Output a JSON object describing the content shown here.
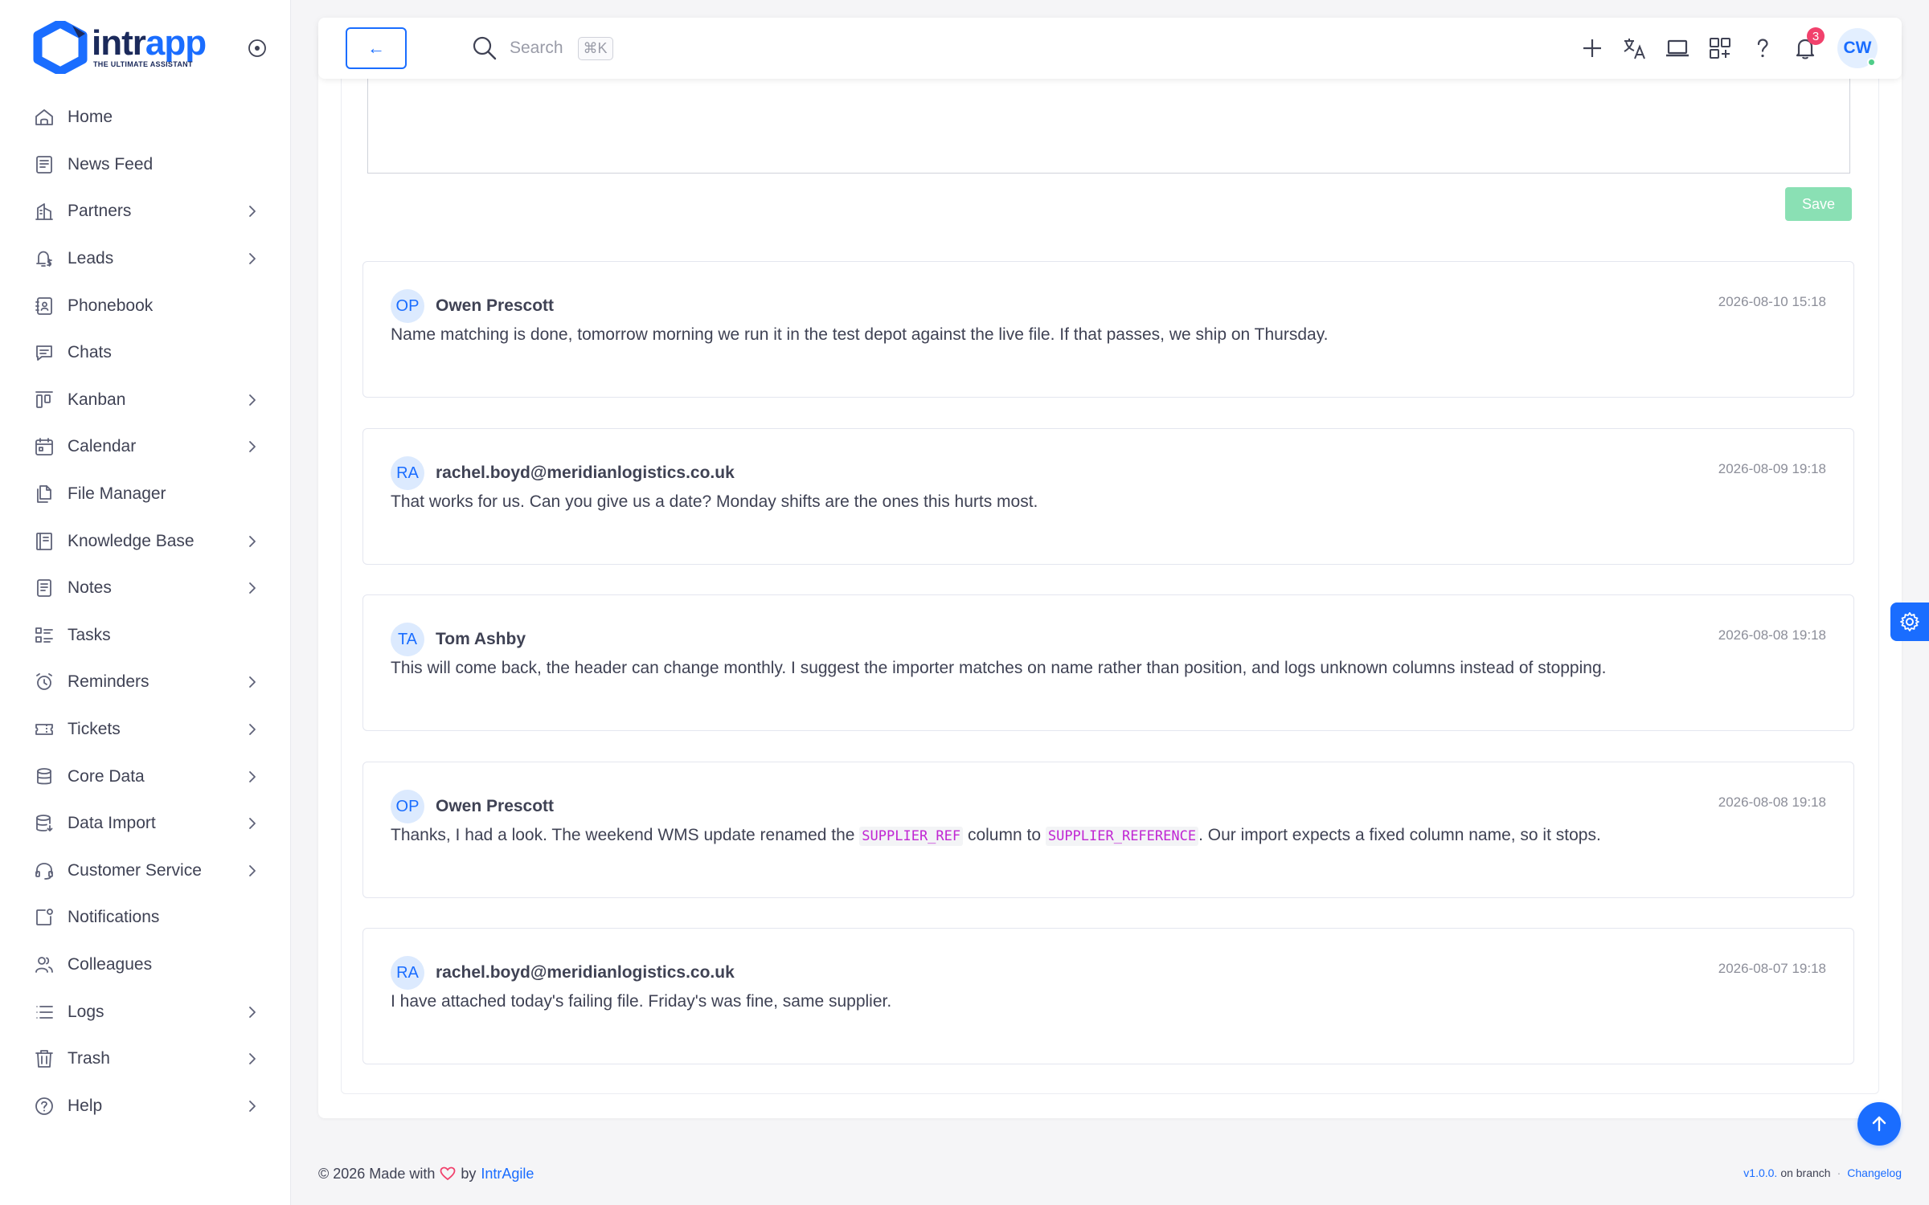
{
  "brand": {
    "name_main": "intr",
    "name_accent": "app",
    "tagline": "THE ULTIMATE ASSISTANT"
  },
  "sidebar": {
    "items": [
      {
        "label": "Home",
        "icon": "home-icon",
        "chevron": false
      },
      {
        "label": "News Feed",
        "icon": "newspaper-icon",
        "chevron": false
      },
      {
        "label": "Partners",
        "icon": "building-icon",
        "chevron": true
      },
      {
        "label": "Leads",
        "icon": "bell-dollar-icon",
        "chevron": true
      },
      {
        "label": "Phonebook",
        "icon": "phonebook-icon",
        "chevron": false
      },
      {
        "label": "Chats",
        "icon": "chat-icon",
        "chevron": false
      },
      {
        "label": "Kanban",
        "icon": "kanban-icon",
        "chevron": true
      },
      {
        "label": "Calendar",
        "icon": "calendar-icon",
        "chevron": true
      },
      {
        "label": "File Manager",
        "icon": "files-icon",
        "chevron": false
      },
      {
        "label": "Knowledge Base",
        "icon": "book-icon",
        "chevron": true
      },
      {
        "label": "Notes",
        "icon": "note-icon",
        "chevron": true
      },
      {
        "label": "Tasks",
        "icon": "tasks-icon",
        "chevron": false
      },
      {
        "label": "Reminders",
        "icon": "alarm-icon",
        "chevron": true
      },
      {
        "label": "Tickets",
        "icon": "ticket-icon",
        "chevron": true
      },
      {
        "label": "Core Data",
        "icon": "database-icon",
        "chevron": true
      },
      {
        "label": "Data Import",
        "icon": "database-import-icon",
        "chevron": true
      },
      {
        "label": "Customer Service",
        "icon": "headset-icon",
        "chevron": true
      },
      {
        "label": "Notifications",
        "icon": "notification-icon",
        "chevron": false
      },
      {
        "label": "Colleagues",
        "icon": "users-icon",
        "chevron": false
      },
      {
        "label": "Logs",
        "icon": "list-icon",
        "chevron": true
      },
      {
        "label": "Trash",
        "icon": "trash-icon",
        "chevron": true
      },
      {
        "label": "Help",
        "icon": "help-circle-icon",
        "chevron": true
      }
    ]
  },
  "topbar": {
    "back_label": "←",
    "search_placeholder": "Search",
    "search_shortcut": "⌘K",
    "notifications_count": "3",
    "user_initials": "CW"
  },
  "editor": {
    "save_label": "Save"
  },
  "comments": [
    {
      "initials": "OP",
      "author": "Owen Prescott",
      "date": "2026-08-10 15:18",
      "text": "Name matching is done, tomorrow morning we run it in the test depot against the live file. If that passes, we ship on Thursday."
    },
    {
      "initials": "RA",
      "author": "rachel.boyd@meridianlogistics.co.uk",
      "date": "2026-08-09 19:18",
      "text": "That works for us. Can you give us a date? Monday shifts are the ones this hurts most."
    },
    {
      "initials": "TA",
      "author": "Tom Ashby",
      "date": "2026-08-08 19:18",
      "text": "This will come back, the header can change monthly. I suggest the importer matches on name rather than position, and logs unknown columns instead of stopping."
    },
    {
      "initials": "OP",
      "author": "Owen Prescott",
      "date": "2026-08-08 19:18",
      "text_before": "Thanks, I had a look. The weekend WMS update renamed the ",
      "code1": "SUPPLIER_REF",
      "text_mid": " column to ",
      "code2": "SUPPLIER_REFERENCE",
      "text_after": ". Our import expects a fixed column name, so it stops."
    },
    {
      "initials": "RA",
      "author": "rachel.boyd@meridianlogistics.co.uk",
      "date": "2026-08-07 19:18",
      "text": "I have attached today's failing file. Friday's was fine, same supplier."
    }
  ],
  "footer": {
    "prefix": "© 2026 Made with",
    "by": "by",
    "company": "IntrAgile",
    "version": "v1.0.0.",
    "branch_text": "on branch",
    "changelog": "Changelog"
  },
  "colors": {
    "primary": "#1a6dff",
    "success_light": "#8ae0b4",
    "danger": "#f1416c",
    "code": "#c026d3"
  }
}
